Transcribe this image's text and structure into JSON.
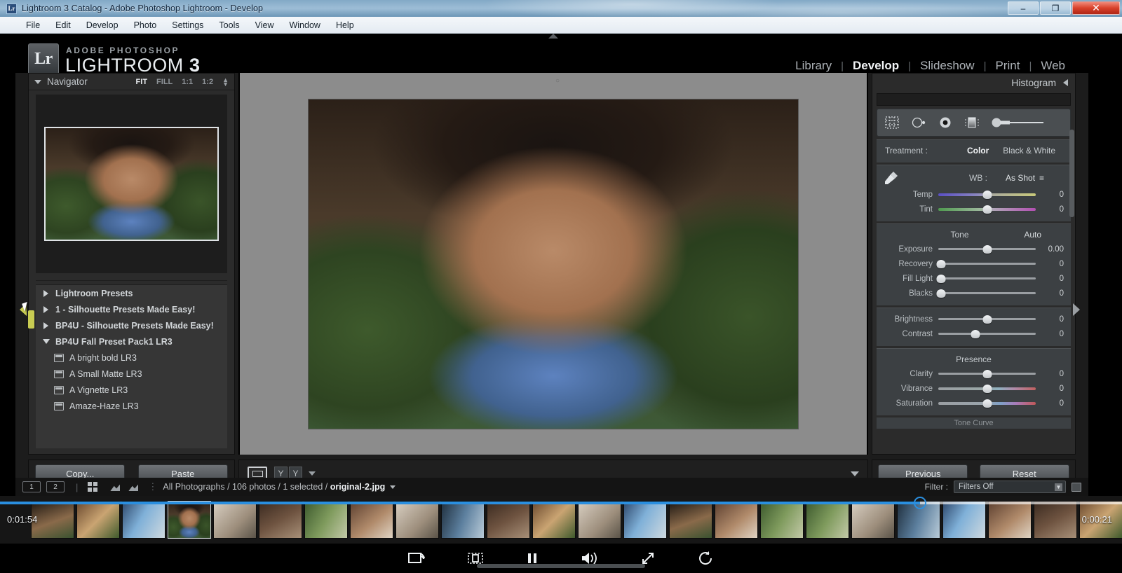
{
  "window": {
    "title": "Lightroom 3 Catalog - Adobe Photoshop Lightroom - Develop",
    "icon": "lightroom-icon",
    "minimize_label": "–",
    "maximize_label": "❐",
    "close_label": "✕"
  },
  "menubar": {
    "items": [
      "File",
      "Edit",
      "Develop",
      "Photo",
      "Settings",
      "Tools",
      "View",
      "Window",
      "Help"
    ]
  },
  "identity": {
    "badge": "Lr",
    "brand_top": "ADOBE PHOTOSHOP",
    "brand_main": "LIGHTROOM",
    "brand_version": "3"
  },
  "modules": {
    "items": [
      {
        "label": "Library",
        "active": false
      },
      {
        "label": "Develop",
        "active": true
      },
      {
        "label": "Slideshow",
        "active": false
      },
      {
        "label": "Print",
        "active": false
      },
      {
        "label": "Web",
        "active": false
      }
    ],
    "separator": "|"
  },
  "navigator": {
    "title": "Navigator",
    "zoom_levels": [
      {
        "label": "FIT",
        "active": true
      },
      {
        "label": "FILL",
        "active": false
      },
      {
        "label": "1:1",
        "active": false
      },
      {
        "label": "1:2",
        "active": false
      }
    ],
    "stepper_icon": "stepper-up-down-icon"
  },
  "presets": {
    "rows": [
      {
        "label": "Lightroom Presets",
        "type": "group",
        "expanded": false
      },
      {
        "label": "1 - Silhouette Presets Made Easy!",
        "type": "group",
        "expanded": false
      },
      {
        "label": "BP4U - Silhouette Presets Made Easy!",
        "type": "group",
        "expanded": false
      },
      {
        "label": "BP4U Fall Preset Pack1 LR3",
        "type": "group",
        "expanded": true
      },
      {
        "label": "A bright bold LR3",
        "type": "child"
      },
      {
        "label": "A Small Matte LR3",
        "type": "child"
      },
      {
        "label": "A Vignette LR3",
        "type": "child"
      },
      {
        "label": "Amaze-Haze LR3",
        "type": "child"
      }
    ]
  },
  "copy_paste": {
    "copy_label": "Copy...",
    "paste_label": "Paste"
  },
  "center_toolbar": {
    "view_icon": "loupe-view-icon",
    "flag_left": "Y",
    "flag_right": "Y",
    "caret_icon": "chevron-down-icon",
    "right_caret_icon": "chevron-down-icon"
  },
  "right_panel": {
    "histogram_title": "Histogram",
    "collapse_icon": "chevron-left-icon",
    "tools": [
      {
        "name": "crop-overlay-icon"
      },
      {
        "name": "spot-removal-icon"
      },
      {
        "name": "red-eye-correction-icon"
      },
      {
        "name": "graduated-filter-icon"
      },
      {
        "name": "adjustment-brush-icon"
      }
    ],
    "treatment": {
      "label": "Treatment :",
      "options": [
        {
          "label": "Color",
          "active": true
        },
        {
          "label": "Black & White",
          "active": false
        }
      ]
    },
    "white_balance": {
      "eyedropper_icon": "white-balance-selector-icon",
      "label": "WB :",
      "value": "As Shot",
      "value_caret": "≡",
      "sliders": [
        {
          "label": "Temp",
          "value": "0",
          "pos": 50,
          "track": "temp"
        },
        {
          "label": "Tint",
          "value": "0",
          "pos": 50,
          "track": "tint"
        }
      ]
    },
    "tone": {
      "title": "Tone",
      "auto_label": "Auto",
      "sliders": [
        {
          "label": "Exposure",
          "value": "0.00",
          "pos": 50,
          "track": "plain"
        },
        {
          "label": "Recovery",
          "value": "0",
          "pos": 2,
          "track": "plain"
        },
        {
          "label": "Fill Light",
          "value": "0",
          "pos": 2,
          "track": "plain"
        },
        {
          "label": "Blacks",
          "value": "0",
          "pos": 2,
          "track": "plain"
        }
      ],
      "sliders2": [
        {
          "label": "Brightness",
          "value": "0",
          "pos": 50,
          "track": "plain"
        },
        {
          "label": "Contrast",
          "value": "0",
          "pos": 38,
          "track": "plain"
        }
      ]
    },
    "presence": {
      "title": "Presence",
      "sliders": [
        {
          "label": "Clarity",
          "value": "0",
          "pos": 50,
          "track": "plain"
        },
        {
          "label": "Vibrance",
          "value": "0",
          "pos": 50,
          "track": "vib"
        },
        {
          "label": "Saturation",
          "value": "0",
          "pos": 50,
          "track": "sat"
        }
      ]
    },
    "next_section_tease": "Tone Curve"
  },
  "previous_reset": {
    "previous_label": "Previous",
    "reset_label": "Reset"
  },
  "status_bar": {
    "page_1": "1",
    "page_2": "2",
    "grid_icon": "grid-view-icon",
    "prev_photo_icon": "previous-photo-icon",
    "next_photo_icon": "next-photo-icon",
    "path_prefix": "All Photographs / 106 photos / 1 selected / ",
    "current_file": "original-2.jpg",
    "caret_icon": "chevron-down-icon",
    "filter_label": "Filter :",
    "filter_value": "Filters Off",
    "filter_caret_icon": "chevron-down-icon",
    "disk_icon": "save-disk-icon"
  },
  "filmstrip": {
    "thumbnails": [
      {
        "style": "ph-thumb-c",
        "selected": false
      },
      {
        "style": "ph-thumb-a",
        "selected": false
      },
      {
        "style": "ph-thumb-b",
        "selected": false
      },
      {
        "style": "ph-thumb-c",
        "selected": true
      },
      {
        "style": "ph-thumb-d",
        "selected": false
      },
      {
        "style": "ph-thumb-h",
        "selected": false
      },
      {
        "style": "ph-thumb-e",
        "selected": false
      },
      {
        "style": "ph-thumb-f",
        "selected": false
      },
      {
        "style": "ph-thumb-d",
        "selected": false
      },
      {
        "style": "ph-thumb-g",
        "selected": false
      },
      {
        "style": "ph-thumb-h",
        "selected": false
      },
      {
        "style": "ph-thumb-a",
        "selected": false
      },
      {
        "style": "ph-thumb-d",
        "selected": false
      },
      {
        "style": "ph-thumb-b",
        "selected": false
      },
      {
        "style": "ph-thumb-c",
        "selected": false
      },
      {
        "style": "ph-thumb-f",
        "selected": false
      },
      {
        "style": "ph-thumb-e",
        "selected": false
      },
      {
        "style": "ph-thumb-e",
        "selected": false
      },
      {
        "style": "ph-thumb-d",
        "selected": false
      },
      {
        "style": "ph-thumb-g",
        "selected": false
      },
      {
        "style": "ph-thumb-b",
        "selected": false
      },
      {
        "style": "ph-thumb-f",
        "selected": false
      },
      {
        "style": "ph-thumb-h",
        "selected": false
      },
      {
        "style": "ph-thumb-a",
        "selected": false
      }
    ]
  },
  "video": {
    "elapsed": "0:01:54",
    "remaining": "0:00:21",
    "progress_percent": 82,
    "controls": [
      {
        "name": "cast-icon"
      },
      {
        "name": "subtitles-icon"
      },
      {
        "name": "pause-icon"
      },
      {
        "name": "volume-icon"
      },
      {
        "name": "fullscreen-icon"
      },
      {
        "name": "replay-icon"
      }
    ]
  },
  "colors": {
    "accent_blue": "#2a8fe0",
    "panel_bg": "#2b2b2b",
    "section_bg": "#3c4043",
    "canvas_gray": "#8c8c8c",
    "highlight_yellow": "#c8cc52"
  }
}
